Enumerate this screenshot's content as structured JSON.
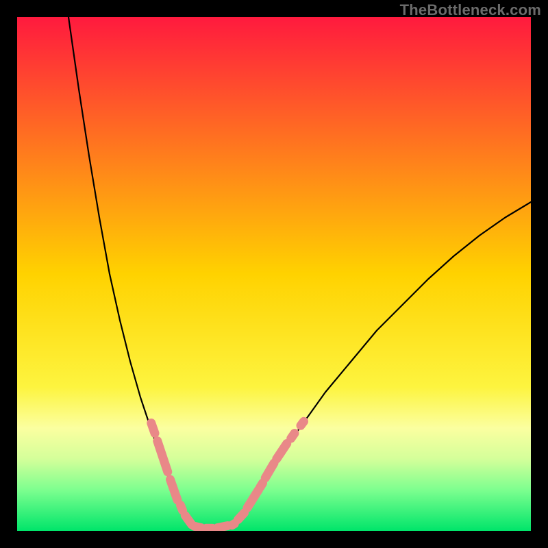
{
  "watermark": "TheBottleneck.com",
  "chart_data": {
    "type": "line",
    "title": "",
    "xlabel": "",
    "ylabel": "",
    "xlim": [
      0,
      100
    ],
    "ylim": [
      0,
      100
    ],
    "grid": false,
    "legend": false,
    "background_gradient": {
      "stops": [
        {
          "offset": 0.0,
          "color": "#ff1a3e"
        },
        {
          "offset": 0.5,
          "color": "#ffd200"
        },
        {
          "offset": 0.72,
          "color": "#fdf43f"
        },
        {
          "offset": 0.8,
          "color": "#fbffa0"
        },
        {
          "offset": 0.86,
          "color": "#d4ff9a"
        },
        {
          "offset": 0.92,
          "color": "#7dff8f"
        },
        {
          "offset": 1.0,
          "color": "#00e56a"
        }
      ]
    },
    "series": [
      {
        "name": "left-branch",
        "x": [
          10.0,
          12.0,
          14.0,
          16.0,
          18.0,
          20.0,
          22.0,
          24.0,
          26.0,
          28.0,
          30.0,
          31.0,
          32.0,
          33.0,
          34.0
        ],
        "y": [
          100.0,
          86.0,
          73.0,
          61.0,
          50.0,
          41.0,
          33.0,
          26.0,
          20.0,
          14.0,
          9.0,
          6.5,
          4.5,
          2.5,
          1.0
        ]
      },
      {
        "name": "valley-floor",
        "x": [
          34.0,
          36.0,
          38.0,
          40.0,
          42.0
        ],
        "y": [
          1.0,
          0.5,
          0.5,
          0.7,
          1.2
        ]
      },
      {
        "name": "right-branch",
        "x": [
          42.0,
          44.0,
          46.0,
          48.0,
          50.0,
          55.0,
          60.0,
          65.0,
          70.0,
          75.0,
          80.0,
          85.0,
          90.0,
          95.0,
          100.0
        ],
        "y": [
          1.2,
          3.0,
          6.0,
          9.5,
          13.0,
          20.0,
          27.0,
          33.0,
          39.0,
          44.0,
          49.0,
          53.5,
          57.5,
          61.0,
          64.0
        ]
      }
    ],
    "overlay_markers": {
      "name": "pink-capsules",
      "color": "#e98888",
      "segments": [
        {
          "x1": 26.1,
          "y1": 21.0,
          "x2": 26.8,
          "y2": 19.0
        },
        {
          "x1": 27.3,
          "y1": 17.5,
          "x2": 29.3,
          "y2": 11.5
        },
        {
          "x1": 29.8,
          "y1": 10.0,
          "x2": 31.2,
          "y2": 6.0
        },
        {
          "x1": 31.8,
          "y1": 5.0,
          "x2": 32.2,
          "y2": 4.0
        },
        {
          "x1": 32.7,
          "y1": 3.0,
          "x2": 34.0,
          "y2": 1.2
        },
        {
          "x1": 34.5,
          "y1": 0.9,
          "x2": 35.8,
          "y2": 0.6
        },
        {
          "x1": 36.8,
          "y1": 0.5,
          "x2": 38.0,
          "y2": 0.5
        },
        {
          "x1": 39.0,
          "y1": 0.6,
          "x2": 41.0,
          "y2": 1.0
        },
        {
          "x1": 41.8,
          "y1": 1.1,
          "x2": 42.3,
          "y2": 1.4
        },
        {
          "x1": 43.0,
          "y1": 2.2,
          "x2": 44.2,
          "y2": 3.5
        },
        {
          "x1": 44.8,
          "y1": 4.5,
          "x2": 47.0,
          "y2": 8.0
        },
        {
          "x1": 47.3,
          "y1": 8.5,
          "x2": 47.8,
          "y2": 9.3
        },
        {
          "x1": 48.3,
          "y1": 10.3,
          "x2": 50.0,
          "y2": 13.2
        },
        {
          "x1": 50.5,
          "y1": 14.0,
          "x2": 52.5,
          "y2": 17.0
        },
        {
          "x1": 53.3,
          "y1": 18.0,
          "x2": 54.0,
          "y2": 19.0
        },
        {
          "x1": 55.2,
          "y1": 20.5,
          "x2": 55.8,
          "y2": 21.3
        }
      ]
    }
  }
}
